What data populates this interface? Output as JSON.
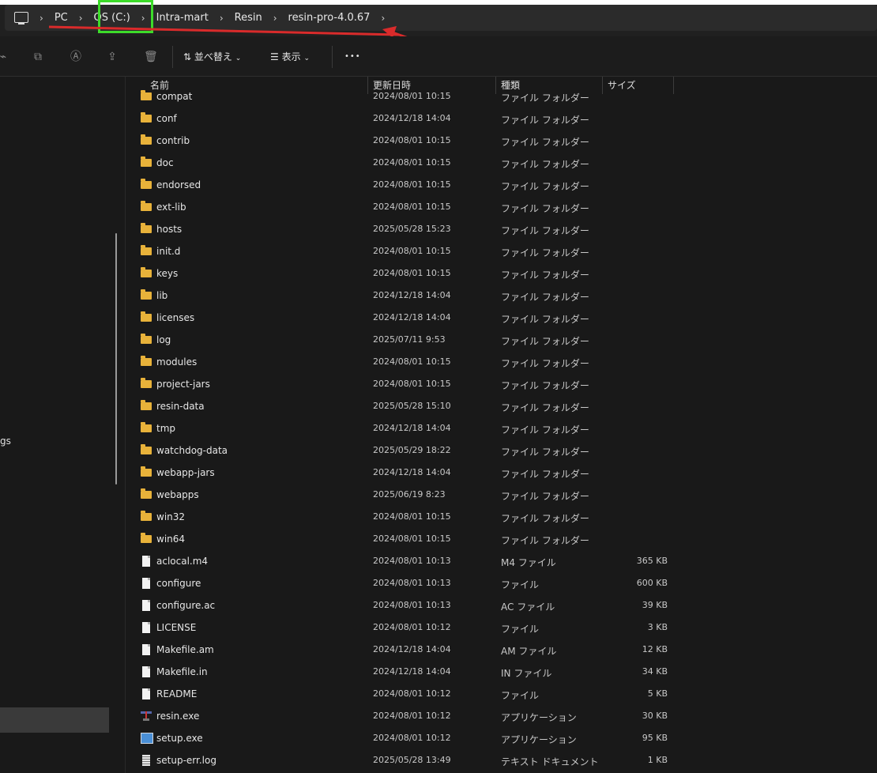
{
  "breadcrumb": {
    "items": [
      "PC",
      "OS (C:)",
      "Intra-mart",
      "Resin",
      "resin-pro-4.0.67"
    ],
    "separator": "›"
  },
  "toolbar": {
    "sort_label": "並べ替え",
    "view_label": "表示",
    "more_label": "•••"
  },
  "columns": {
    "name": "名前",
    "date": "更新日時",
    "type": "種類",
    "size": "サイズ"
  },
  "sidebar": {
    "partial_label": "gs"
  },
  "rows": [
    {
      "name": "compat",
      "date": "2024/08/01 10:15",
      "type": "ファイル フォルダー",
      "size": "",
      "icon": "folder"
    },
    {
      "name": "conf",
      "date": "2024/12/18 14:04",
      "type": "ファイル フォルダー",
      "size": "",
      "icon": "folder"
    },
    {
      "name": "contrib",
      "date": "2024/08/01 10:15",
      "type": "ファイル フォルダー",
      "size": "",
      "icon": "folder"
    },
    {
      "name": "doc",
      "date": "2024/08/01 10:15",
      "type": "ファイル フォルダー",
      "size": "",
      "icon": "folder"
    },
    {
      "name": "endorsed",
      "date": "2024/08/01 10:15",
      "type": "ファイル フォルダー",
      "size": "",
      "icon": "folder"
    },
    {
      "name": "ext-lib",
      "date": "2024/08/01 10:15",
      "type": "ファイル フォルダー",
      "size": "",
      "icon": "folder"
    },
    {
      "name": "hosts",
      "date": "2025/05/28 15:23",
      "type": "ファイル フォルダー",
      "size": "",
      "icon": "folder"
    },
    {
      "name": "init.d",
      "date": "2024/08/01 10:15",
      "type": "ファイル フォルダー",
      "size": "",
      "icon": "folder"
    },
    {
      "name": "keys",
      "date": "2024/08/01 10:15",
      "type": "ファイル フォルダー",
      "size": "",
      "icon": "folder"
    },
    {
      "name": "lib",
      "date": "2024/12/18 14:04",
      "type": "ファイル フォルダー",
      "size": "",
      "icon": "folder"
    },
    {
      "name": "licenses",
      "date": "2024/12/18 14:04",
      "type": "ファイル フォルダー",
      "size": "",
      "icon": "folder"
    },
    {
      "name": "log",
      "date": "2025/07/11 9:53",
      "type": "ファイル フォルダー",
      "size": "",
      "icon": "folder"
    },
    {
      "name": "modules",
      "date": "2024/08/01 10:15",
      "type": "ファイル フォルダー",
      "size": "",
      "icon": "folder"
    },
    {
      "name": "project-jars",
      "date": "2024/08/01 10:15",
      "type": "ファイル フォルダー",
      "size": "",
      "icon": "folder"
    },
    {
      "name": "resin-data",
      "date": "2025/05/28 15:10",
      "type": "ファイル フォルダー",
      "size": "",
      "icon": "folder"
    },
    {
      "name": "tmp",
      "date": "2024/12/18 14:04",
      "type": "ファイル フォルダー",
      "size": "",
      "icon": "folder"
    },
    {
      "name": "watchdog-data",
      "date": "2025/05/29 18:22",
      "type": "ファイル フォルダー",
      "size": "",
      "icon": "folder"
    },
    {
      "name": "webapp-jars",
      "date": "2024/12/18 14:04",
      "type": "ファイル フォルダー",
      "size": "",
      "icon": "folder"
    },
    {
      "name": "webapps",
      "date": "2025/06/19 8:23",
      "type": "ファイル フォルダー",
      "size": "",
      "icon": "folder"
    },
    {
      "name": "win32",
      "date": "2024/08/01 10:15",
      "type": "ファイル フォルダー",
      "size": "",
      "icon": "folder"
    },
    {
      "name": "win64",
      "date": "2024/08/01 10:15",
      "type": "ファイル フォルダー",
      "size": "",
      "icon": "folder"
    },
    {
      "name": "aclocal.m4",
      "date": "2024/08/01 10:13",
      "type": "M4 ファイル",
      "size": "365 KB",
      "icon": "file"
    },
    {
      "name": "configure",
      "date": "2024/08/01 10:13",
      "type": "ファイル",
      "size": "600 KB",
      "icon": "file"
    },
    {
      "name": "configure.ac",
      "date": "2024/08/01 10:13",
      "type": "AC ファイル",
      "size": "39 KB",
      "icon": "file"
    },
    {
      "name": "LICENSE",
      "date": "2024/08/01 10:12",
      "type": "ファイル",
      "size": "3 KB",
      "icon": "file"
    },
    {
      "name": "Makefile.am",
      "date": "2024/12/18 14:04",
      "type": "AM ファイル",
      "size": "12 KB",
      "icon": "file"
    },
    {
      "name": "Makefile.in",
      "date": "2024/12/18 14:04",
      "type": "IN ファイル",
      "size": "34 KB",
      "icon": "file"
    },
    {
      "name": "README",
      "date": "2024/08/01 10:12",
      "type": "ファイル",
      "size": "5 KB",
      "icon": "file"
    },
    {
      "name": "resin.exe",
      "date": "2024/08/01 10:12",
      "type": "アプリケーション",
      "size": "30 KB",
      "icon": "exe-resin"
    },
    {
      "name": "setup.exe",
      "date": "2024/08/01 10:12",
      "type": "アプリケーション",
      "size": "95 KB",
      "icon": "exe-setup"
    },
    {
      "name": "setup-err.log",
      "date": "2025/05/28 13:49",
      "type": "テキスト ドキュメント",
      "size": "1 KB",
      "icon": "log"
    }
  ],
  "colors": {
    "annotation_red": "#d92b2b",
    "annotation_green": "#3ddc2a",
    "folder": "#e8b23a"
  }
}
